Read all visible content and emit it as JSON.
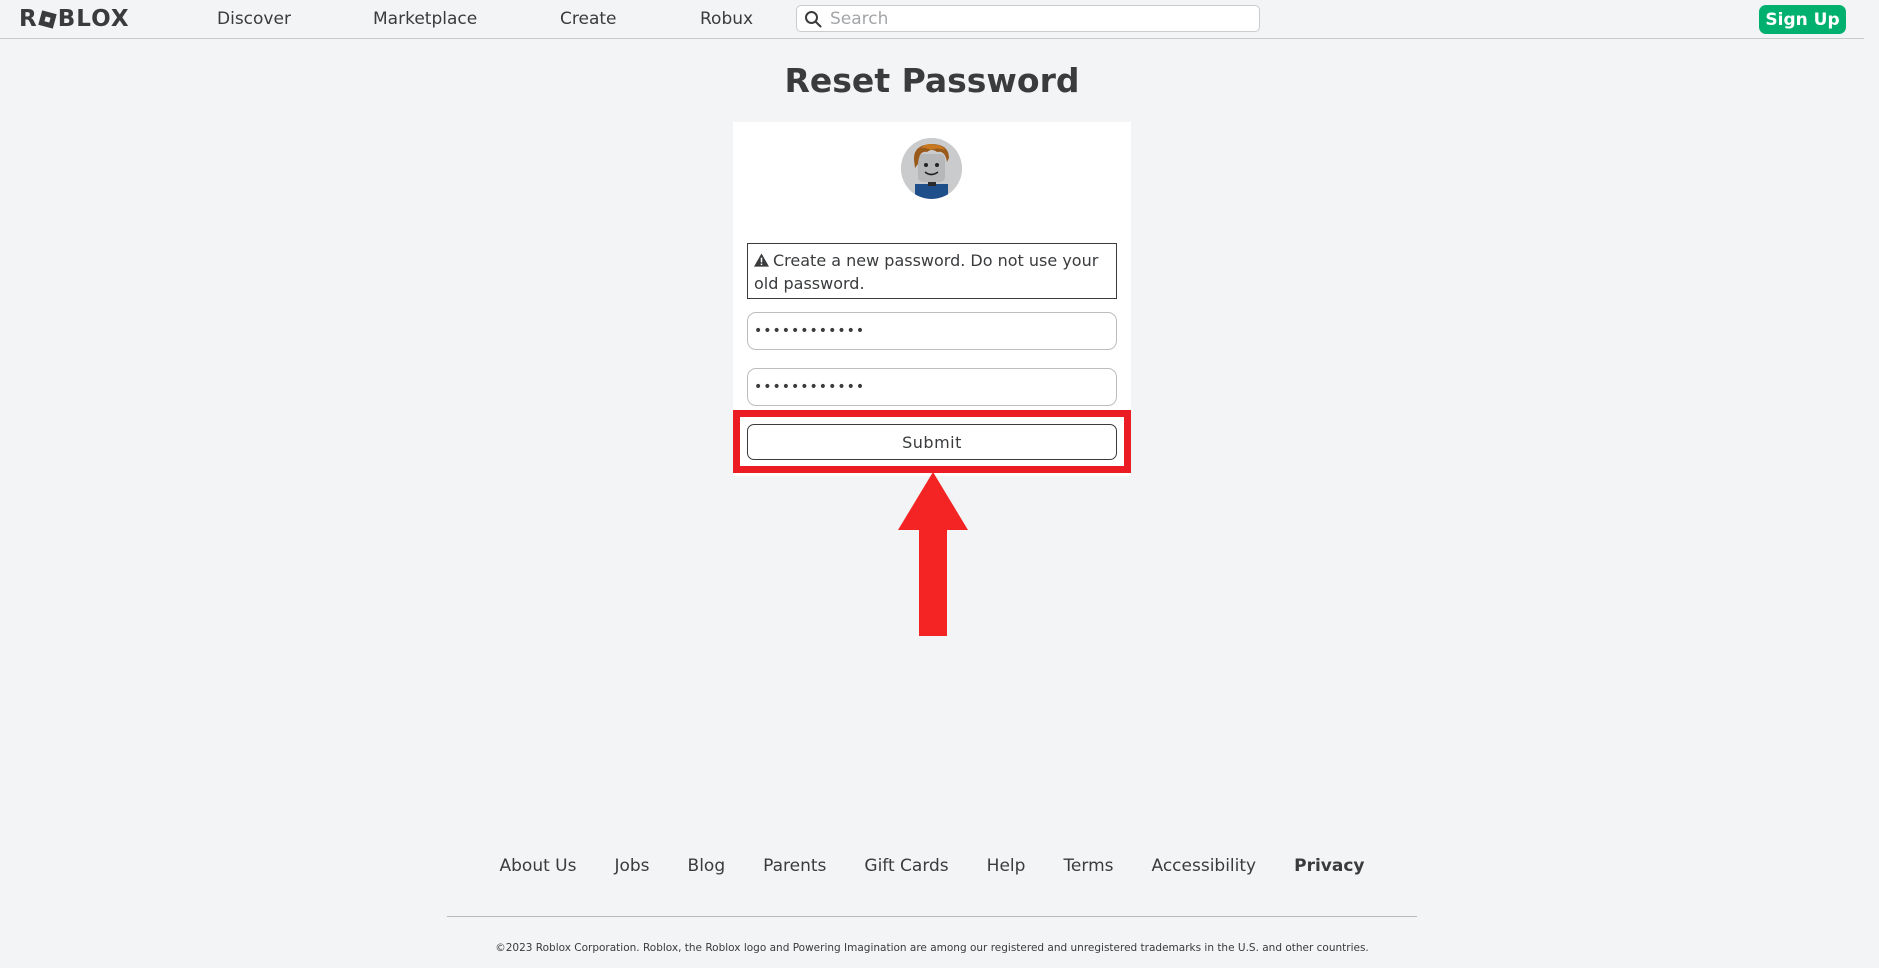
{
  "nav": {
    "logo": "ROBLOX",
    "links": [
      "Discover",
      "Marketplace",
      "Create",
      "Robux"
    ],
    "search_placeholder": "Search",
    "signup_label": "Sign Up"
  },
  "page": {
    "title": "Reset Password",
    "warning": "Create a new password. Do not use your old password.",
    "password_value": "••••••••••••",
    "confirm_password_value": "••••••••••••",
    "submit_label": "Submit"
  },
  "footer": {
    "links": [
      "About Us",
      "Jobs",
      "Blog",
      "Parents",
      "Gift Cards",
      "Help",
      "Terms",
      "Accessibility",
      "Privacy"
    ],
    "copyright": "©2023 Roblox Corporation. Roblox, the Roblox logo and Powering Imagination are among our registered and unregistered trademarks in the U.S. and other countries."
  },
  "colors": {
    "signup": "#00b06f",
    "annotation": "#ec1c24",
    "background": "#f2f4f5"
  }
}
